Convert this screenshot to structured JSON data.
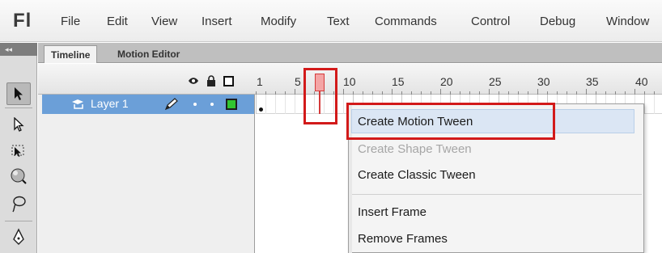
{
  "app": {
    "logo": "Fl"
  },
  "menubar": {
    "items": [
      "File",
      "Edit",
      "View",
      "Insert",
      "Modify",
      "Text",
      "Commands",
      "Control",
      "Debug",
      "Window"
    ]
  },
  "panel_tabs": {
    "timeline": "Timeline",
    "motion_editor": "Motion Editor"
  },
  "toolpanel": {
    "grip": "◂◂"
  },
  "timeline": {
    "frame_numbers": [
      "1",
      "5",
      "10",
      "15",
      "20",
      "25",
      "30",
      "35",
      "40"
    ],
    "current_frame": 10,
    "layer": {
      "name": "Layer 1",
      "outline_color": "#31c531"
    }
  },
  "context_menu": {
    "items": [
      {
        "label": "Create Motion Tween",
        "enabled": true,
        "highlighted": true
      },
      {
        "label": "Create Shape Tween",
        "enabled": false
      },
      {
        "label": "Create Classic Tween",
        "enabled": true
      },
      {
        "label": "Insert Frame",
        "enabled": true
      },
      {
        "label": "Remove Frames",
        "enabled": true
      }
    ]
  },
  "colors": {
    "highlight_box": "#d21a1a",
    "layer_selected": "#6b9fd8",
    "playhead": "#f4a5a5"
  }
}
